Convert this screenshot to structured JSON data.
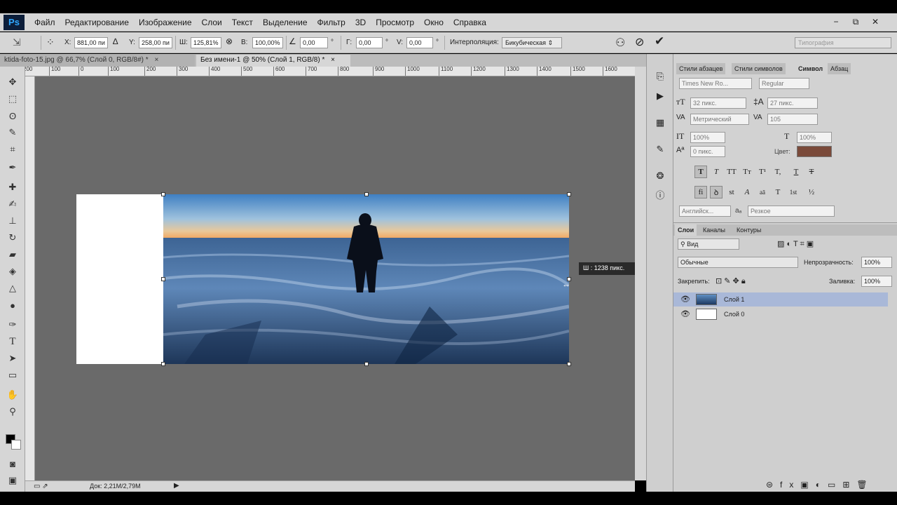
{
  "app": {
    "logo": "Ps",
    "accent": "#31a8ff"
  },
  "menu": [
    "Файл",
    "Редактирование",
    "Изображение",
    "Слои",
    "Текст",
    "Выделение",
    "Фильтр",
    "3D",
    "Просмотр",
    "Окно",
    "Справка"
  ],
  "window_controls": {
    "minimize": "−",
    "restore": "⧉",
    "close": "✕"
  },
  "options": {
    "x_label": "X:",
    "x_value": "881,00 пи",
    "y_label": "Y:",
    "y_value": "258,00 пи",
    "w_label": "Ш:",
    "w_value": "125,81%",
    "h_label": "В:",
    "h_value": "100,00%",
    "angle_value": "0,00",
    "degree": "°",
    "hskew_label": "Г:",
    "hskew_value": "0,00",
    "vskew_label": "V:",
    "vskew_value": "0,00",
    "interp_label": "Интерполяция:",
    "interp_value": "Бикубическая",
    "workspace": "Типография"
  },
  "tabs": [
    {
      "label": "ktida-foto-15.jpg @ 66,7% (Слой 0, RGB/8#) *",
      "close": "×"
    },
    {
      "label": "Без имени-1 @ 50% (Слой 1, RGB/8) *",
      "close": "×"
    }
  ],
  "ruler_ticks": [
    "200",
    "100",
    "0",
    "100",
    "200",
    "300",
    "400",
    "500",
    "600",
    "700",
    "800",
    "900",
    "1000",
    "1100",
    "1200",
    "1300",
    "1400",
    "1500",
    "1600"
  ],
  "transform_tip": "Ш :  1238 пикс.",
  "status": {
    "doc_info": "Док: 2,21M/2,79M"
  },
  "character_panel": {
    "tabs": [
      "Стили абзацев",
      "Стили символов",
      "Символ",
      "Абзац"
    ],
    "font_family": "Times New Ro...",
    "font_style": "Regular",
    "font_size": "32 пикс.",
    "leading": "27 пикс.",
    "kerning": "Метрический",
    "tracking": "105",
    "vscale": "100%",
    "hscale": "100%",
    "baseline": "0 пикс.",
    "color_label": "Цвет:",
    "color_value": "#7a4a3a",
    "type_buttons": [
      "T",
      "T",
      "TT",
      "Tт",
      "T¹",
      "T,",
      "T",
      "T"
    ],
    "ot_buttons": [
      "fi",
      "ꝺ",
      "st",
      "A",
      "aā",
      "T",
      "1st",
      "½"
    ],
    "language": "Английск...",
    "antialias_label": "aₐ",
    "antialias": "Резкое"
  },
  "layers_panel": {
    "tabs": [
      "Слои",
      "Каналы",
      "Контуры"
    ],
    "filter_kind": "Вид",
    "blend_mode": "Обычные",
    "opacity_label": "Непрозрачность:",
    "opacity_value": "100%",
    "lock_label": "Закрепить:",
    "fill_label": "Заливка:",
    "fill_value": "100%",
    "layers": [
      {
        "name": "Слой 1",
        "selected": true
      },
      {
        "name": "Слой 0",
        "selected": false
      }
    ]
  }
}
